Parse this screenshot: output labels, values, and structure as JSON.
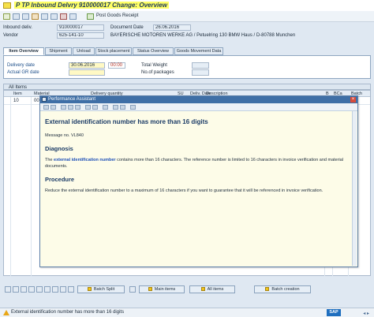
{
  "window": {
    "title": "P TP Inbound Delvry 910000017 Change: Overview"
  },
  "toolbar": {
    "post_goods_receipt": "Post Goods Receipt"
  },
  "header": {
    "inbound_delv_label": "Inbound deliv.",
    "inbound_delv_value": "910000017",
    "vendor_label": "Vendor",
    "vendor_value": "625-141-10",
    "doc_date_label": "Document Date",
    "doc_date_value": "26.06.2016",
    "vendor_name": "BAYERISCHE MOTOREN WERKE AG / Petuelring 130 BMW Haus / D-80788 Munchen"
  },
  "tabs": [
    "Item Overview",
    "Shipment",
    "Unload",
    "Stock placement",
    "Status Overview",
    "Goods Movement Data"
  ],
  "item_overview": {
    "delivery_date_label": "Delivery date",
    "delivery_date_value": "30.06.2016",
    "delivery_time_value": "00:00",
    "actual_gr_date_label": "Actual GR date",
    "total_weight_label": "Total Weight",
    "no_packages_label": "No.of packages"
  },
  "items": {
    "section_label": "All Items",
    "columns": {
      "item": "Item",
      "material": "Material",
      "delivery_qty": "Delivery quantity",
      "su": "SU",
      "deliv_date": "Deliv. Date",
      "description": "Description",
      "b": "B",
      "bca": "BCa",
      "batch": "Batch"
    },
    "rows": [
      {
        "item": "10",
        "material": "00"
      }
    ]
  },
  "dialog": {
    "title": "Performance Assistant",
    "heading": "External identification number has more than 16 digits",
    "message_no": "Message no. VL840",
    "diagnosis_heading": "Diagnosis",
    "diagnosis_prefix": "The",
    "diagnosis_link": "external identification number",
    "diagnosis_rest": "contains more than 16 characters. The reference number is limited to 16 characters in invoice verification and material",
    "diagnosis_line2": "documents.",
    "procedure_heading": "Procedure",
    "procedure_text": "Reduce the external identification number to a maximum of 16 characters if you want to guarantee that it will be referenced in invoice verification."
  },
  "buttons": {
    "batch_split": "Batch Split",
    "main_items": "Main items",
    "all_items": "All items",
    "batch_creation": "Batch creation"
  },
  "status": {
    "message": "External identification number has more than 16 digits",
    "sap": "SAP"
  },
  "icons": {
    "warning": "warning-icon",
    "close": "close-icon",
    "app": "app-icon"
  },
  "colors": {
    "accent": "#3f6fa6",
    "required_field": "#fff9c4",
    "warning": "#e8a617"
  }
}
